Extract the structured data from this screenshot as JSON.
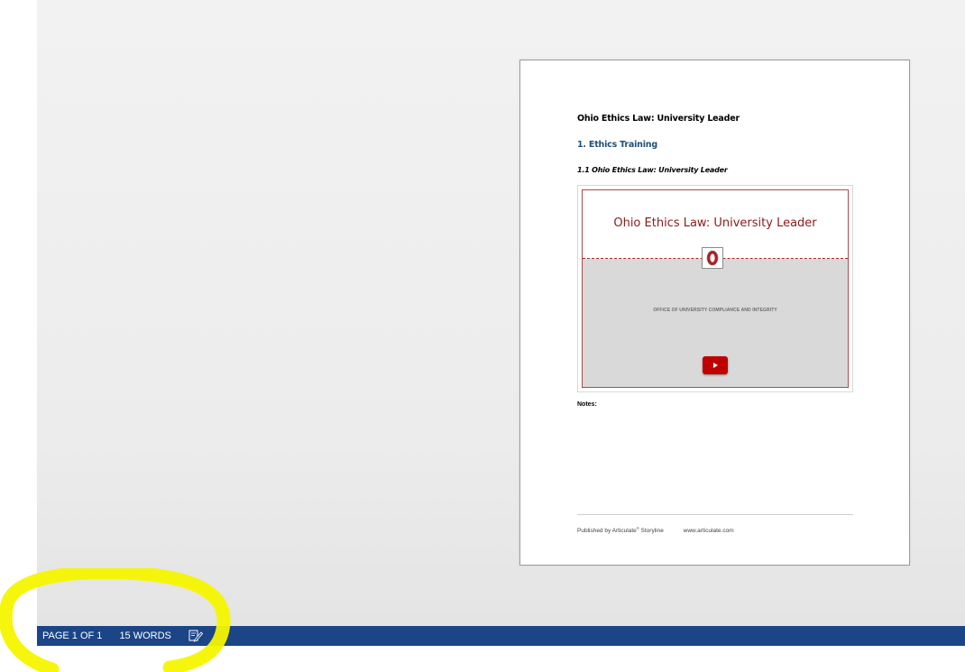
{
  "document": {
    "title": "Ohio Ethics Law: University Leader",
    "heading1": "1. Ethics Training",
    "heading2": "1.1 Ohio Ethics Law: University Leader",
    "slide": {
      "title": "Ohio Ethics Law: University Leader",
      "logo_letter": "O",
      "subtitle": "OFFICE OF UNIVERSITY COMPLIANCE AND INTEGRITY",
      "play_icon": "play-icon"
    },
    "notes_label": "Notes:",
    "footer": {
      "published_by": "Published by Articulate",
      "trademark": "®",
      "product": " Storyline",
      "url": "www.articulate.com"
    }
  },
  "statusbar": {
    "page": "PAGE 1 OF 1",
    "words": "15 WORDS",
    "proofing_icon": "proofing-icon"
  },
  "colors": {
    "statusbar": "#1c4587",
    "heading_blue": "#1f4e79",
    "slide_red": "#8b1a1a",
    "highlight": "#f5f500"
  }
}
